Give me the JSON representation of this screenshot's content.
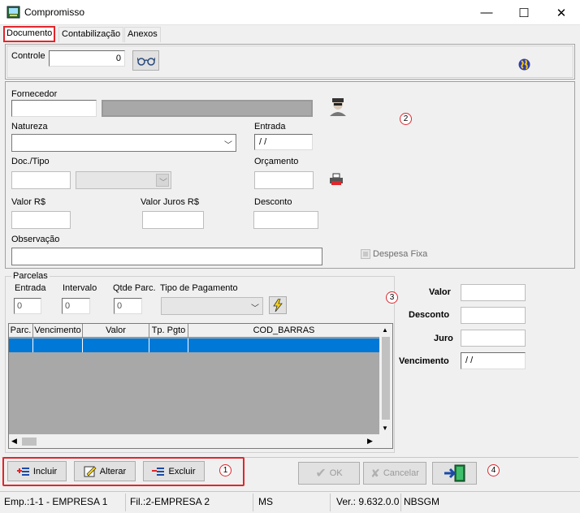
{
  "window": {
    "title": "Compromisso",
    "minimize": "—",
    "maximize": "☐",
    "close": "✕"
  },
  "tabs": [
    "Documento",
    "Contabilização",
    "Anexos"
  ],
  "controle": {
    "label": "Controle",
    "value": "0"
  },
  "form": {
    "fornecedor_label": "Fornecedor",
    "natureza_label": "Natureza",
    "entrada_label": "Entrada",
    "entrada_value": " / /",
    "doc_tipo_label": "Doc./Tipo",
    "orcamento_label": "Orçamento",
    "valor_label": "Valor R$",
    "valor_juros_label": "Valor Juros R$",
    "desconto_label": "Desconto",
    "observacao_label": "Observação",
    "despesa_fixa_label": "Despesa Fixa"
  },
  "parcelas": {
    "group_label": "Parcelas",
    "entrada_label": "Entrada",
    "entrada_value": "0",
    "intervalo_label": "Intervalo",
    "intervalo_value": "0",
    "qtde_label": "Qtde Parc.",
    "qtde_value": "0",
    "tipo_pagamento_label": "Tipo de Pagamento",
    "columns": [
      "Parc.",
      "Vencimento",
      "Valor",
      "Tp. Pgto",
      "COD_BARRAS"
    ]
  },
  "side": {
    "valor_label": "Valor",
    "desconto_label": "Desconto",
    "juro_label": "Juro",
    "vencimento_label": "Vencimento",
    "vencimento_value": " / /"
  },
  "actions": {
    "incluir": "Incluir",
    "alterar": "Alterar",
    "excluir": "Excluir",
    "ok": "OK",
    "cancelar": "Cancelar"
  },
  "annotations": [
    "1",
    "2",
    "3",
    "4"
  ],
  "status": {
    "emp": "Emp.:1-1 - EMPRESA 1",
    "fil": "Fil.:2-EMPRESA 2",
    "uf": "MS",
    "ver": "Ver.: 9.632.0.0",
    "user": "NBSGM"
  },
  "colors": {
    "accent": "#e0262c",
    "selection": "#0078d7",
    "disabled_fill": "#a8a8a8"
  }
}
